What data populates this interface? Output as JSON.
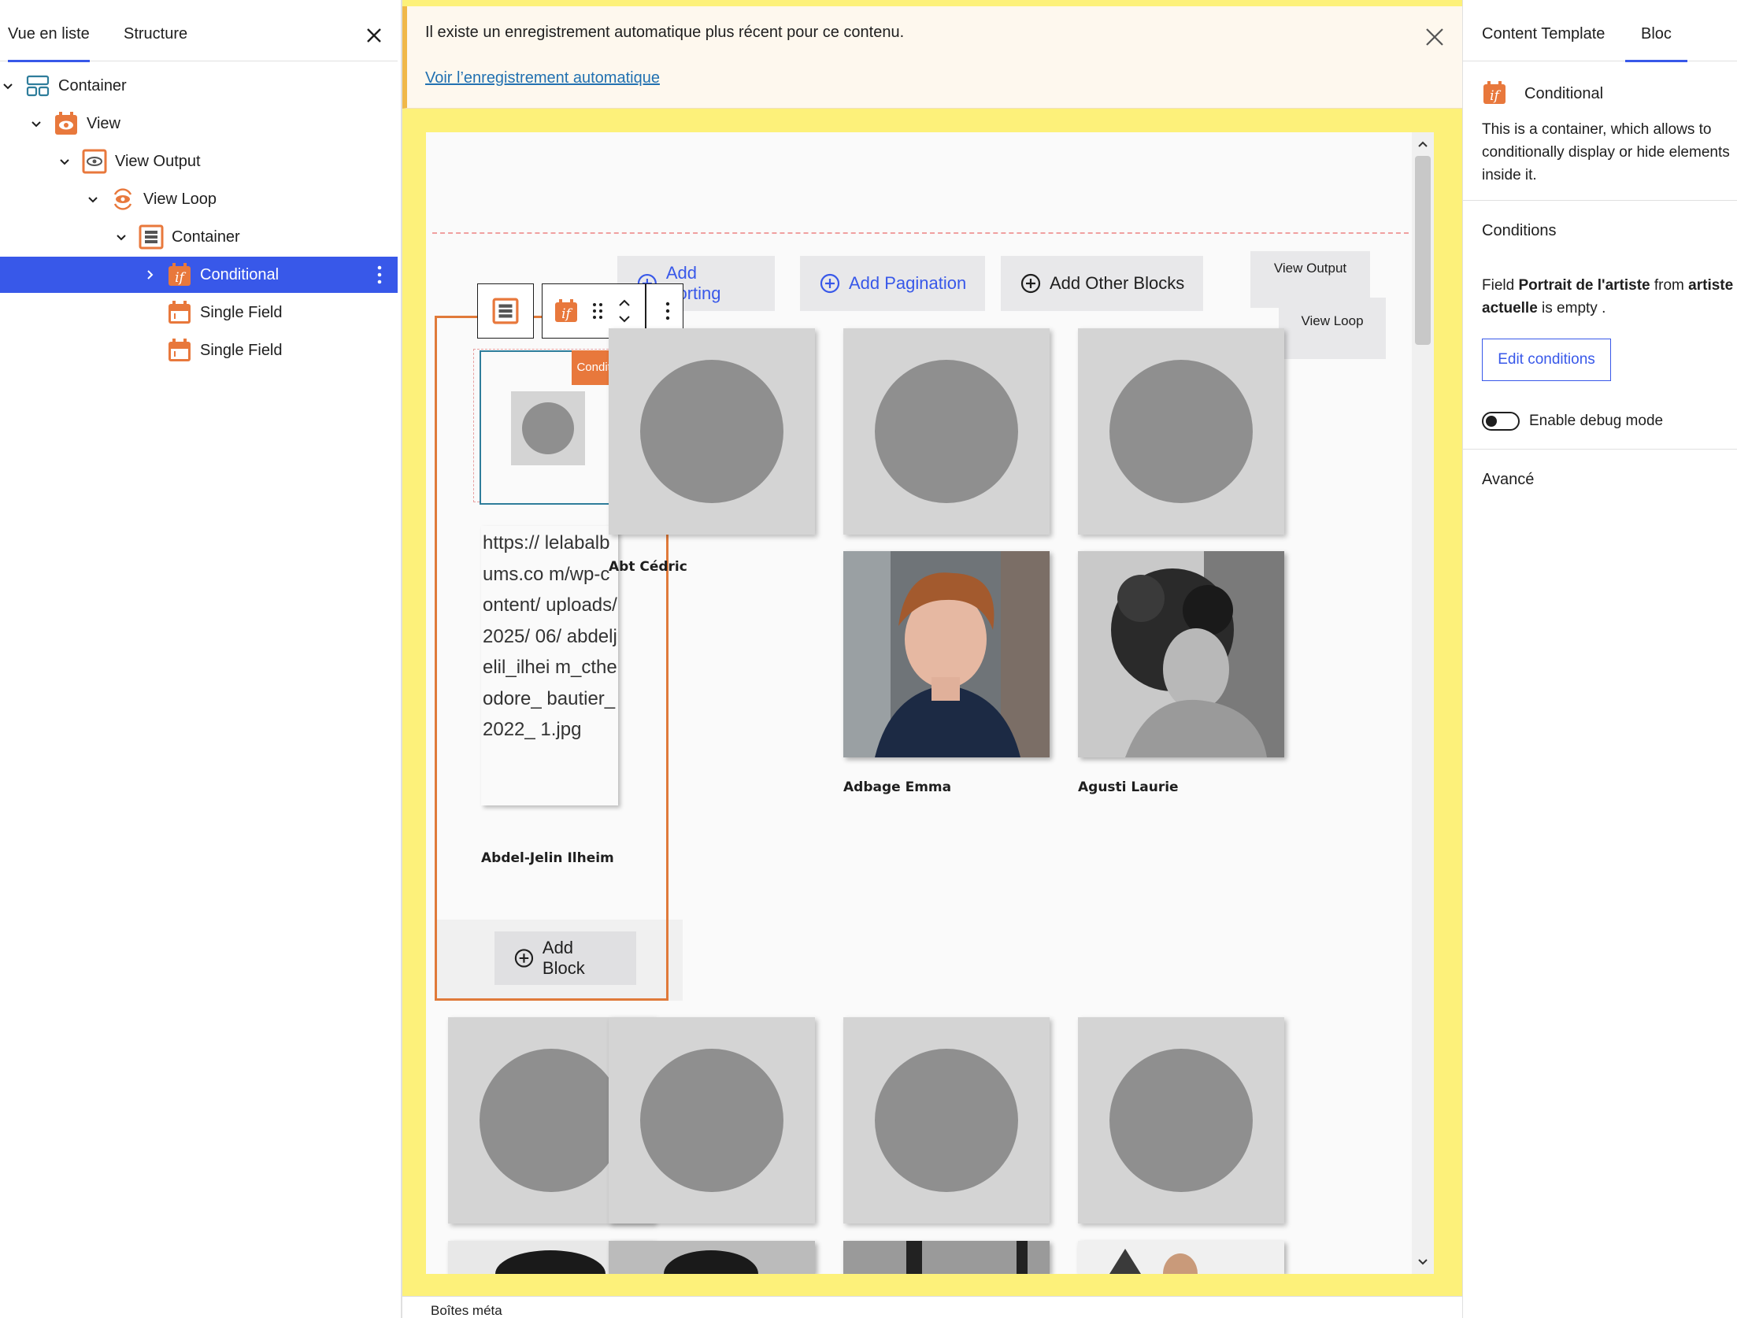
{
  "left_panel": {
    "tabs": [
      "Vue en liste",
      "Structure"
    ],
    "tree": [
      {
        "label": "Container",
        "icon": "container-icon"
      },
      {
        "label": "View",
        "icon": "view-icon"
      },
      {
        "label": "View Output",
        "icon": "view-output-icon"
      },
      {
        "label": "View Loop",
        "icon": "view-loop-icon"
      },
      {
        "label": "Container",
        "icon": "container-stack-icon"
      },
      {
        "label": "Conditional",
        "icon": "conditional-icon",
        "selected": true
      },
      {
        "label": "Single Field",
        "icon": "single-field-icon"
      },
      {
        "label": "Single Field",
        "icon": "single-field-icon"
      }
    ]
  },
  "notice": {
    "message": "Il existe un enregistrement automatique plus récent pour ce contenu.",
    "link": "Voir l’enregistrement automatique"
  },
  "canvas": {
    "buttons": {
      "sorting": "Add Sorting",
      "pagination": "Add Pagination",
      "other": "Add Other Blocks",
      "add_block": "Add Block"
    },
    "tags": {
      "view_output": "View Output",
      "view_loop": "View Loop"
    },
    "conditional_label": "Conditional",
    "url_text": "https:// lelabalbums.co m/wp-content/ uploads/2025/ 06/ abdeljelil_ilhei m_ctheodore_ bautier_2022_ 1.jpg",
    "names": [
      "Abdel-Jelin Ilheim",
      "Abt Cédric",
      "Adbage Emma",
      "Agusti Laurie"
    ]
  },
  "right_panel": {
    "tabs": [
      "Content Template",
      "Bloc"
    ],
    "block_title": "Conditional",
    "block_desc": "This is a container, which allows to conditionally display or hide elements inside it.",
    "conditions_heading": "Conditions",
    "cond_field_prefix": "Field",
    "cond_field": "Portrait de l'artiste",
    "cond_from": "from",
    "cond_source": "artiste actuelle",
    "cond_suffix": "is empty .",
    "edit_button": "Edit conditions",
    "debug_label": "Enable debug mode",
    "advanced": "Avancé"
  },
  "bottom": {
    "meta_label": "Boîtes méta"
  },
  "colors": {
    "accent": "#3858e9",
    "orange": "#e8783c",
    "canvas_bg": "#fdf17a"
  }
}
